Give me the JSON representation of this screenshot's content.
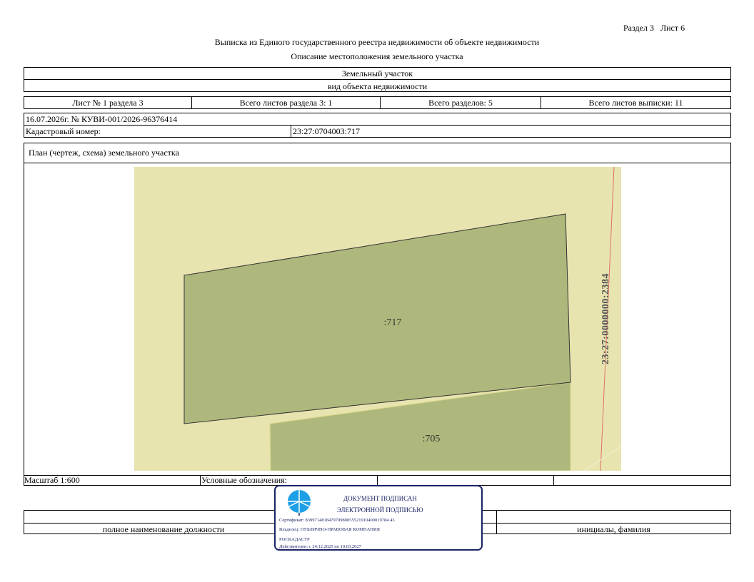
{
  "header": {
    "section_sheet": "Раздел 3   Лист 6",
    "title": "Выписка из Единого государственного реестра недвижимости об объекте недвижимости",
    "subtitle": "Описание местоположения земельного участка"
  },
  "object": {
    "type": "Земельный участок",
    "type_caption": "вид объекта недвижимости"
  },
  "sheets": {
    "sheet_no": "Лист № 1 раздела 3",
    "total_sheets_section": "Всего листов раздела 3: 1",
    "total_sections": "Всего разделов: 5",
    "total_sheets_extract": "Всего листов выписки: 11"
  },
  "info": {
    "date_number": "16.07.2026г. № КУВИ-001/2026-96376414",
    "cadastral_label": "Кадастровый номер:",
    "cadastral_value": "23:27:0704003:717"
  },
  "plan": {
    "title": "План (чертеж, схема) земельного участка",
    "parcel_main_label": ":717",
    "parcel_secondary_label": ":705",
    "parcel_road_label": "23:27:0000000:2384",
    "colors": {
      "background": "#e8e4b0",
      "parcel_fill": "#afb87c",
      "boundary_red": "#e0706a"
    }
  },
  "legend": {
    "scale": "Масштаб 1:600",
    "symbols_label": "Условные обозначения:"
  },
  "signature": {
    "position_caption": "полное наименование должности",
    "name_caption": "инициалы, фамилия"
  },
  "stamp": {
    "line1": "ДОКУМЕНТ ПОДПИСАН",
    "line2": "ЭЛЕКТРОННОЙ ПОДПИСЬЮ",
    "certificate": "Сертификат: 839971481847979980055521910400019784 43",
    "owner": "Владелец: ПУБЛИЧНО-ПРАВОВАЯ КОМПАНИЯ",
    "owner2": "РОСКАДАСТР",
    "valid": "Действителен: с 24.12.2025 по 19.03.2027",
    "color": "#1a2466",
    "icon": "roskadastr-emblem-icon"
  }
}
